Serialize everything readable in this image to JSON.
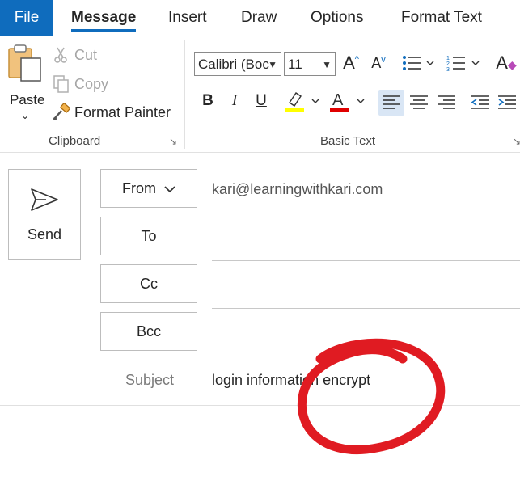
{
  "tabs": {
    "file": "File",
    "message": "Message",
    "insert": "Insert",
    "draw": "Draw",
    "options": "Options",
    "format_text": "Format Text"
  },
  "clipboard": {
    "paste": "Paste",
    "cut": "Cut",
    "copy": "Copy",
    "format_painter": "Format Painter",
    "group_label": "Clipboard"
  },
  "basic_text": {
    "font_name": "Calibri (Boc",
    "font_size": "11",
    "group_label": "Basic Text",
    "highlight_color": "#ffff00",
    "font_color": "#e00000"
  },
  "compose": {
    "send": "Send",
    "from": "From",
    "to": "To",
    "cc": "Cc",
    "bcc": "Bcc",
    "from_value": "kari@learningwithkari.com",
    "subject_label": "Subject",
    "subject_value": "login information encrypt"
  },
  "colors": {
    "accent": "#0f6cbd",
    "annotation": "#e01b22"
  }
}
